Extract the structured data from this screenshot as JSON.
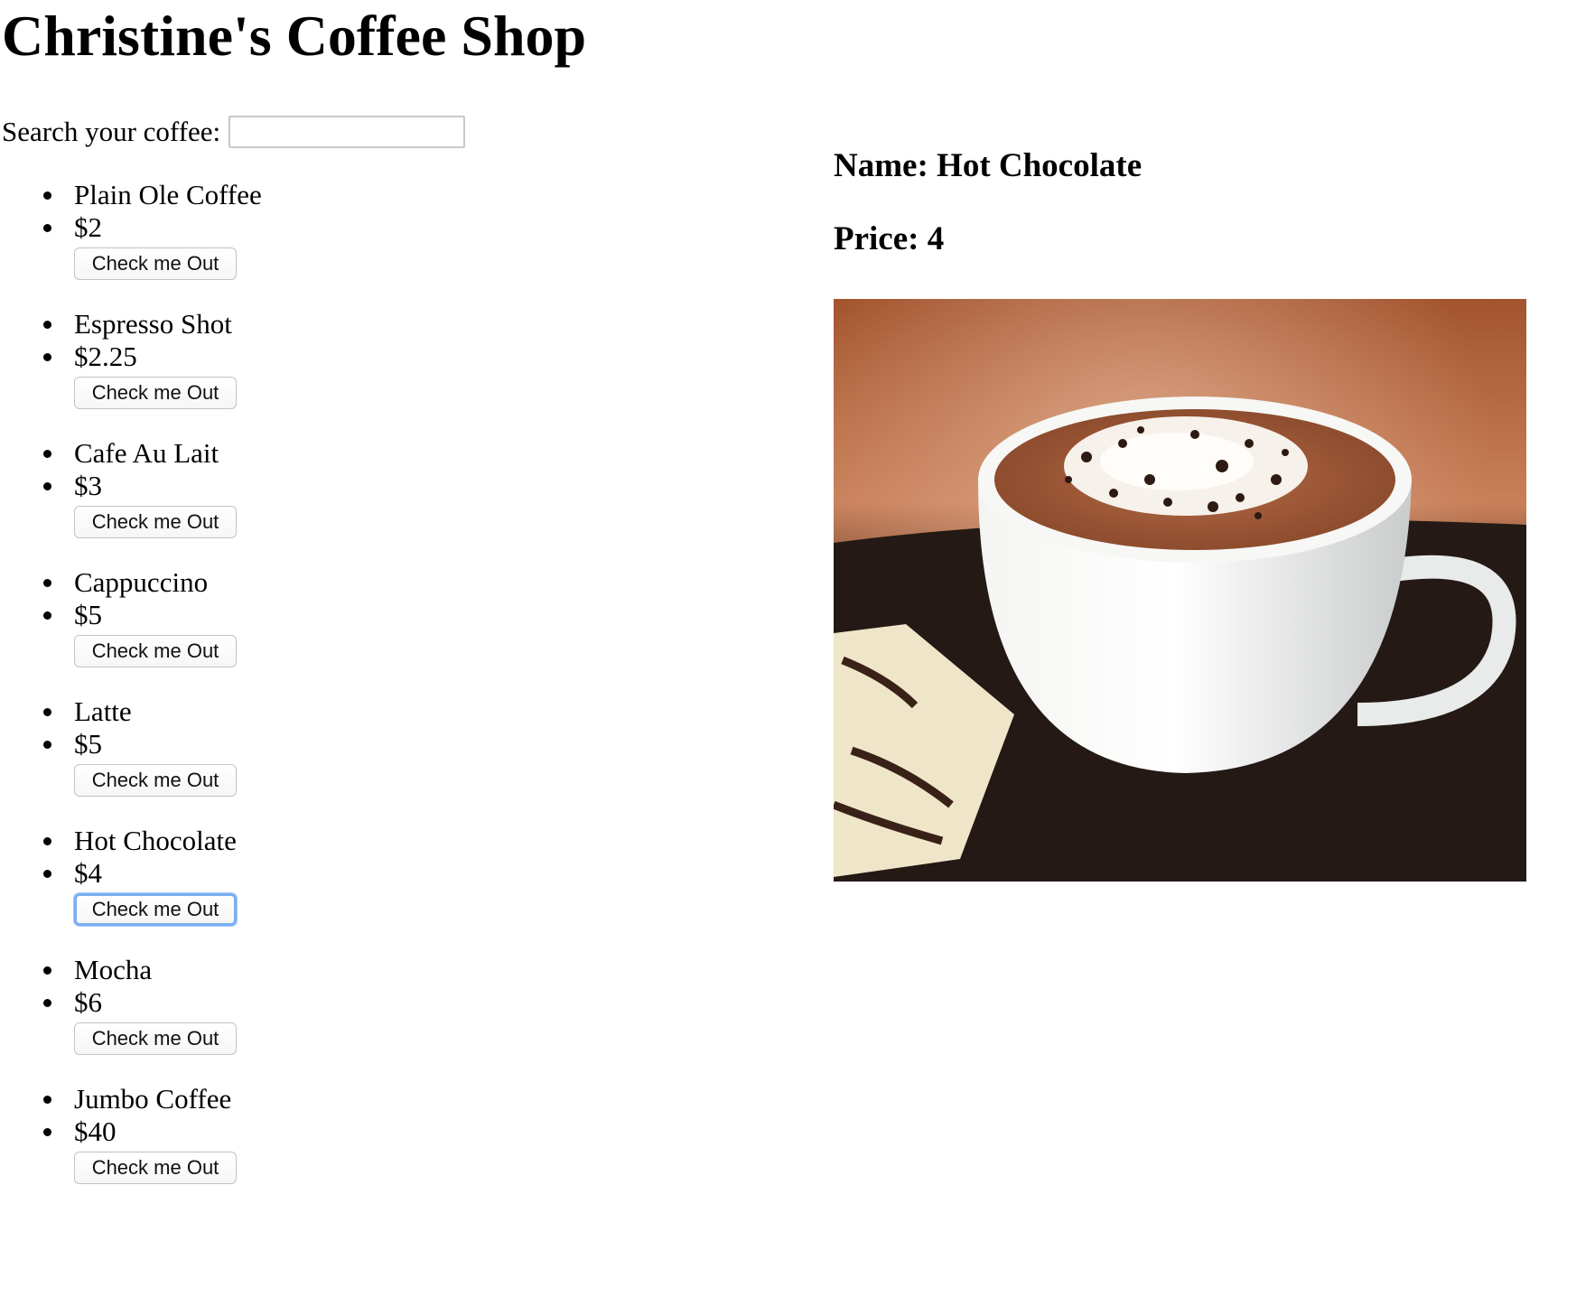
{
  "shop": {
    "title": "Christine's Coffee Shop"
  },
  "search": {
    "label": "Search your coffee:",
    "value": "",
    "placeholder": ""
  },
  "coffees": [
    {
      "name": "Plain Ole Coffee",
      "price": "$2",
      "button": "Check me Out"
    },
    {
      "name": "Espresso Shot",
      "price": "$2.25",
      "button": "Check me Out"
    },
    {
      "name": "Cafe Au Lait",
      "price": "$3",
      "button": "Check me Out"
    },
    {
      "name": "Cappuccino",
      "price": "$5",
      "button": "Check me Out"
    },
    {
      "name": "Latte",
      "price": "$5",
      "button": "Check me Out"
    },
    {
      "name": "Hot Chocolate",
      "price": "$4",
      "button": "Check me Out",
      "focused": true
    },
    {
      "name": "Mocha",
      "price": "$6",
      "button": "Check me Out"
    },
    {
      "name": "Jumbo Coffee",
      "price": "$40",
      "button": "Check me Out"
    }
  ],
  "detail": {
    "name_text": "Name: Hot Chocolate",
    "price_text": "Price: 4",
    "image_subject": "hot-chocolate-cup"
  },
  "colors": {
    "focus_ring": "#7aaef2",
    "button_border": "#c3c3c3"
  }
}
